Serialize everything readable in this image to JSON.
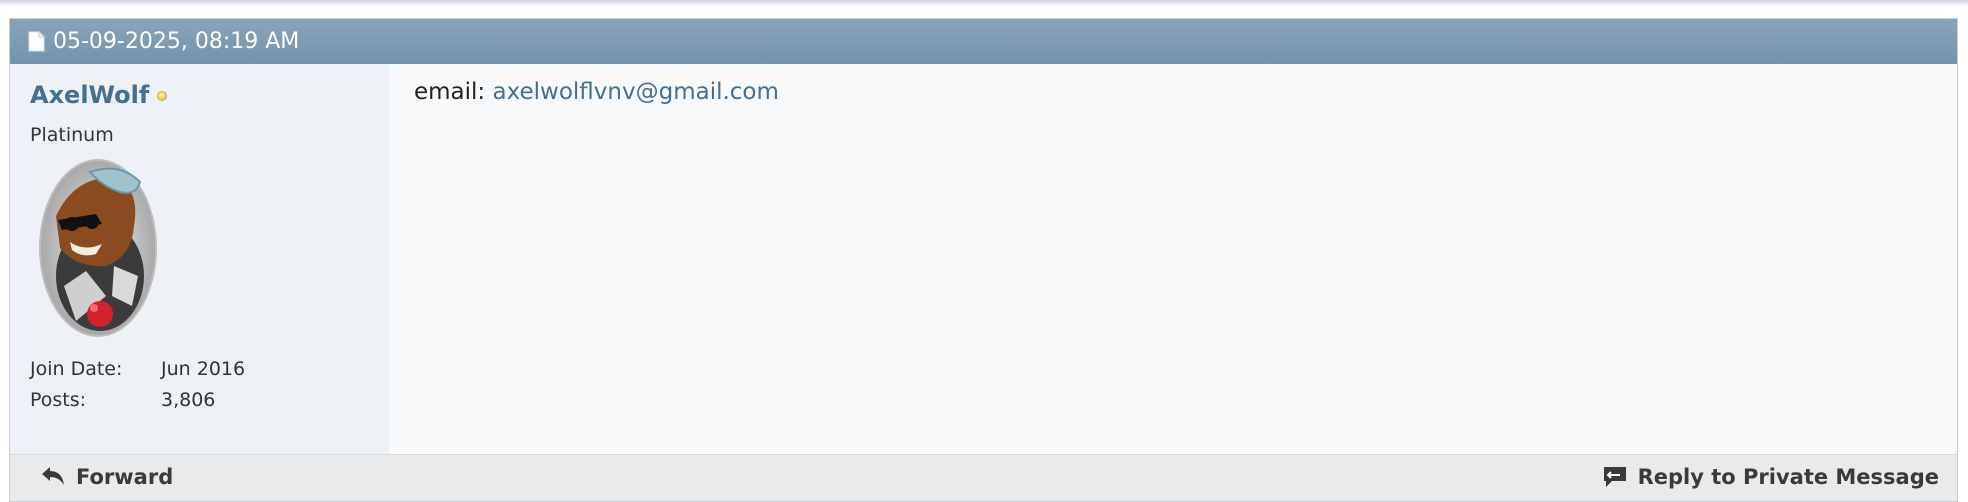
{
  "message": {
    "date": "05-09-2025, 08:19 AM",
    "body_label": "email:",
    "body_email": "axelwolflvnv@gmail.com"
  },
  "user": {
    "username": "AxelWolf",
    "rank": "Platinum",
    "stats": [
      {
        "label": "Join Date:",
        "value": "Jun 2016"
      },
      {
        "label": "Posts:",
        "value": "3,806"
      }
    ],
    "status": "offline"
  },
  "actions": {
    "forward": "Forward",
    "reply": "Reply to Private Message"
  },
  "icons": [
    "document-icon",
    "status-dot-icon",
    "forward-arrow-icon",
    "reply-bubble-icon"
  ],
  "colors": {
    "header": "#7b97ae",
    "username": "#43708f",
    "sidebar": "#eef2f6"
  }
}
